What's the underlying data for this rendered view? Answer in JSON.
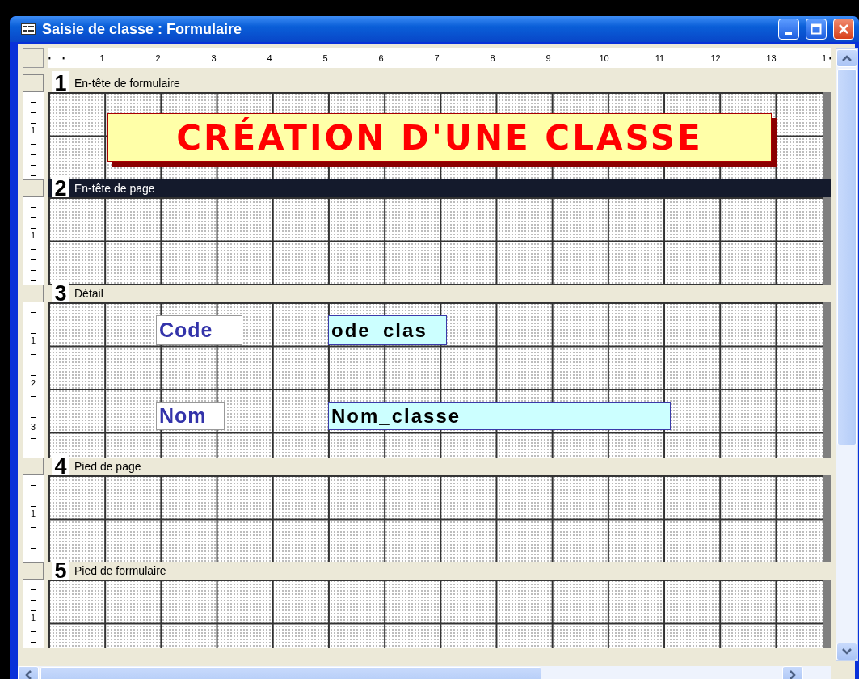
{
  "window": {
    "title": "Saisie de classe : Formulaire"
  },
  "ruler": {
    "labels": [
      "1",
      "2",
      "3",
      "4",
      "5",
      "6",
      "7",
      "8",
      "9",
      "10",
      "11",
      "12",
      "13",
      "1"
    ]
  },
  "sections": [
    {
      "number": "1",
      "label": "En-tête de formulaire",
      "selected": false,
      "vertical_ruler": [
        "1"
      ],
      "controls": [
        {
          "kind": "title",
          "text": "CRÉATION D'UNE CLASSE"
        }
      ]
    },
    {
      "number": "2",
      "label": "En-tête de page",
      "selected": true,
      "vertical_ruler": [
        "1"
      ]
    },
    {
      "number": "3",
      "label": "Détail",
      "selected": false,
      "vertical_ruler": [
        "1",
        "2",
        "3"
      ],
      "controls": [
        {
          "kind": "label",
          "text": "Code"
        },
        {
          "kind": "textbox",
          "text": "ode_clas"
        },
        {
          "kind": "label",
          "text": "Nom"
        },
        {
          "kind": "textbox",
          "text": "Nom_classe"
        }
      ]
    },
    {
      "number": "4",
      "label": "Pied de page",
      "selected": false,
      "vertical_ruler": [
        "1"
      ]
    },
    {
      "number": "5",
      "label": "Pied de formulaire",
      "selected": false,
      "vertical_ruler": [
        "1"
      ]
    }
  ]
}
